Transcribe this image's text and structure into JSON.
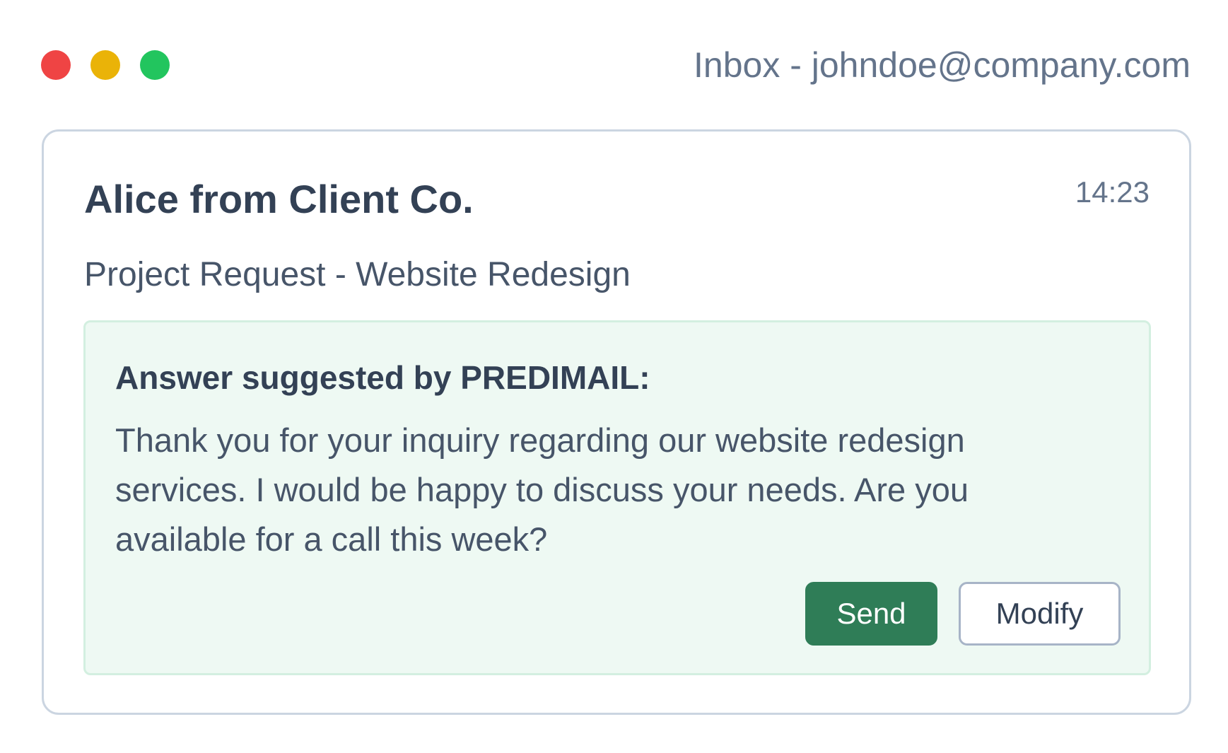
{
  "window": {
    "title": "Inbox - johndoe@company.com",
    "traffic_lights": {
      "close_color": "#ef4444",
      "minimize_color": "#eab308",
      "maximize_color": "#22c55e"
    }
  },
  "email": {
    "sender": "Alice from Client Co.",
    "time": "14:23",
    "subject": "Project Request - Website Redesign"
  },
  "suggestion": {
    "heading": "Answer suggested by PREDIMAIL:",
    "body": "Thank you for your inquiry regarding our website redesign services. I would be happy to discuss your needs. Are you available for a call this week?",
    "send_label": "Send",
    "modify_label": "Modify",
    "send_color": "#2f7d57",
    "background_color": "#eef9f3"
  }
}
